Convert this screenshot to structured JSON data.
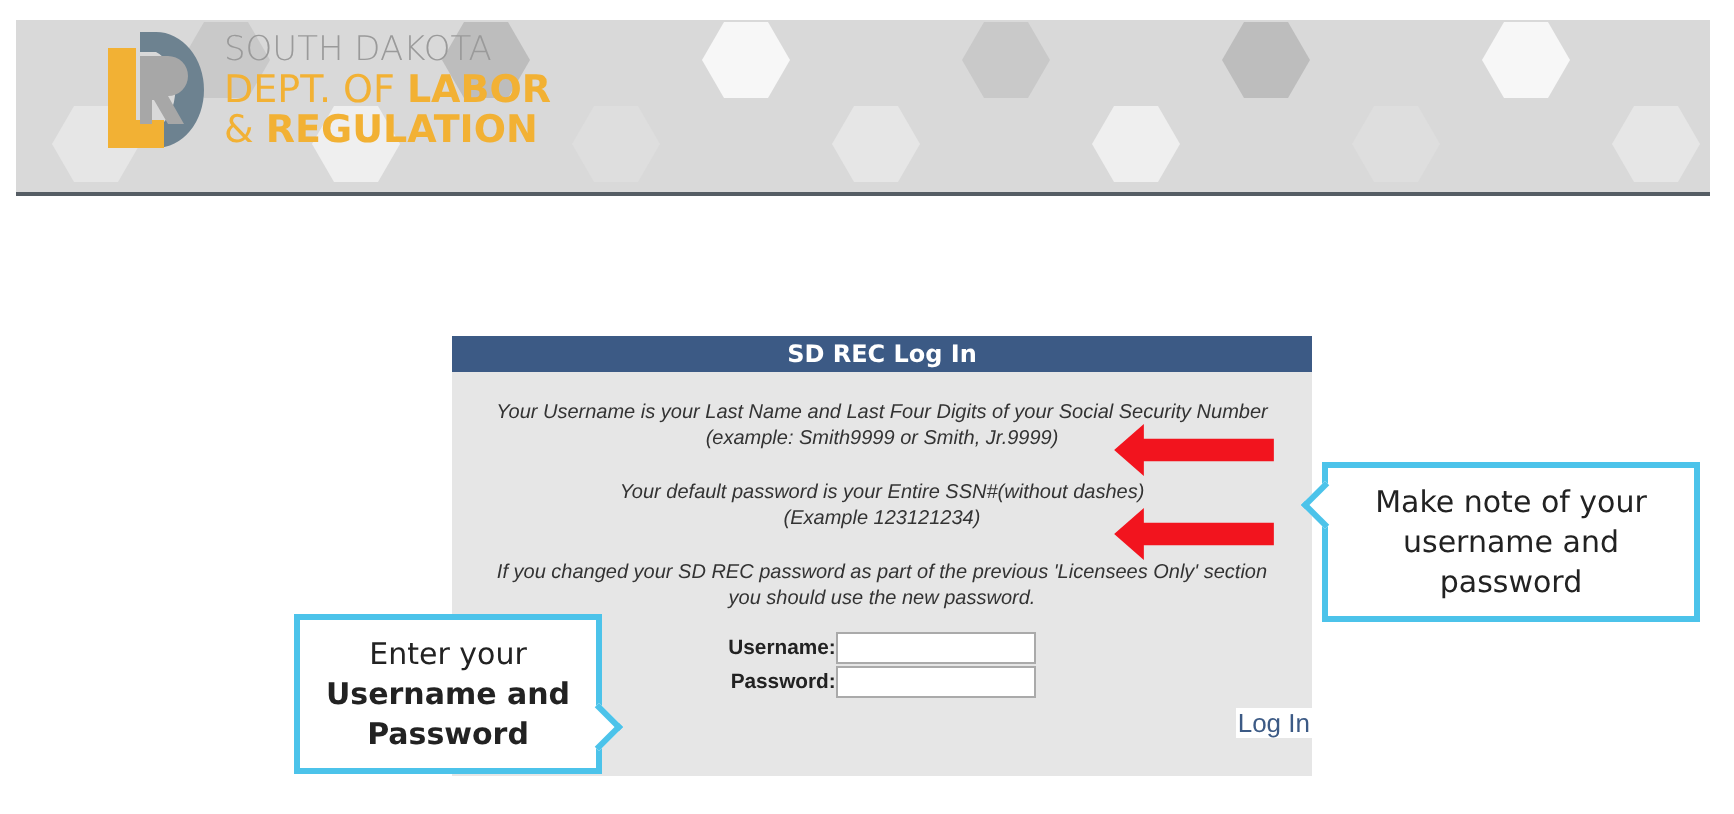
{
  "header": {
    "org_lines": [
      "SOUTH DAKOTA",
      "DEPT. OF **LABOR**",
      "& **REGULATION**"
    ]
  },
  "login": {
    "title": "SD REC Log In",
    "notes": [
      [
        "Your Username is your Last Name and Last Four Digits of your Social Security Number",
        "(example: Smith9999 or Smith, Jr.9999)"
      ],
      [
        "Your default password is your Entire SSN#(without dashes)",
        "(Example 123121234)"
      ],
      [
        "If you changed your SD REC password as part of the previous 'Licensees Only' section",
        "you should use the new password."
      ]
    ],
    "fields": [
      {
        "label": "Username:"
      },
      {
        "label": "Password:"
      }
    ],
    "button": "Log In"
  },
  "callouts": [
    {
      "kind": "right",
      "text": "Make note of your username and password"
    },
    {
      "kind": "left",
      "text": "Enter your **Username and Password**"
    }
  ]
}
